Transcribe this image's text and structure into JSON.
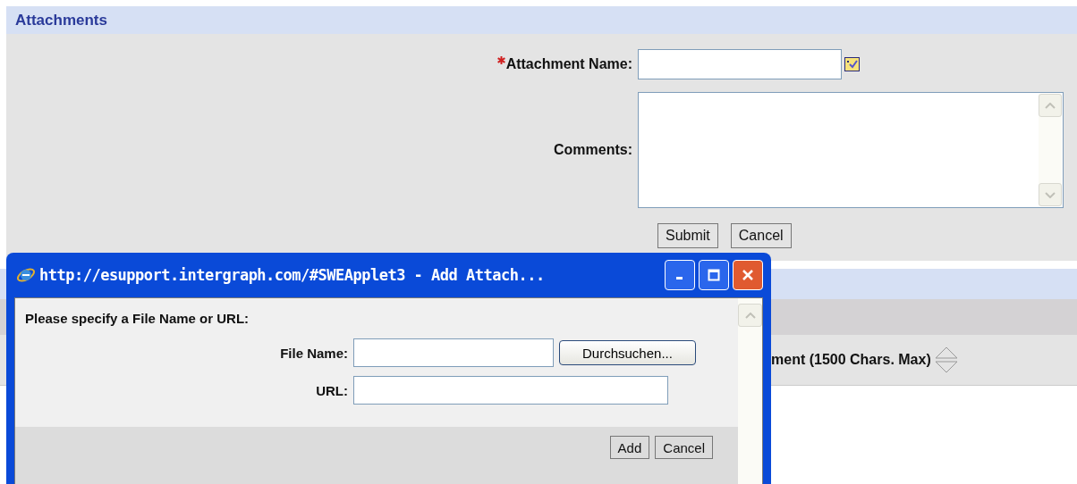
{
  "section": {
    "title": "Attachments"
  },
  "form": {
    "fields": [
      {
        "kind": "text",
        "label": "Attachment Name:",
        "required": true
      },
      {
        "kind": "textarea",
        "label": "Comments:",
        "required": false
      }
    ],
    "buttons": [
      "Submit",
      "Cancel"
    ]
  },
  "list_applet": {
    "column_header": "ment (1500 Chars. Max)"
  },
  "popup": {
    "title": "http://esupport.intergraph.com/#SWEApplet3 - Add Attach...",
    "prompt": "Please specify a File Name or URL:",
    "fields": [
      {
        "kind": "file",
        "label": "File Name:",
        "browse": "Durchsuchen..."
      },
      {
        "kind": "url",
        "label": "URL:"
      }
    ],
    "buttons": [
      "Add",
      "Cancel"
    ]
  }
}
